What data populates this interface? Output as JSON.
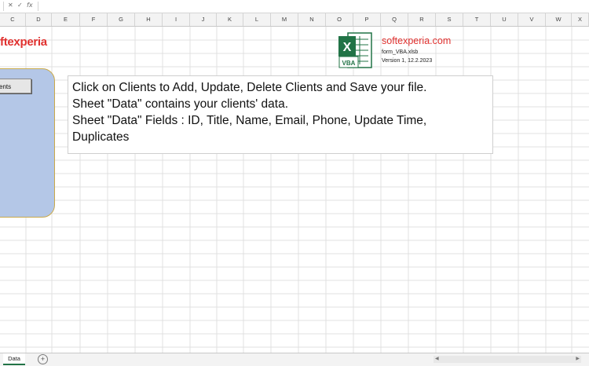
{
  "formula_bar": {
    "cancel": "✕",
    "enter": "✓",
    "fx": "fx"
  },
  "columns": [
    "C",
    "D",
    "E",
    "F",
    "G",
    "H",
    "I",
    "J",
    "K",
    "L",
    "M",
    "N",
    "O",
    "P",
    "Q",
    "R",
    "S",
    "T",
    "U",
    "V",
    "W",
    "X"
  ],
  "logo_text": "ftexperia",
  "clients_button_label": "ents",
  "info_lines": [
    "Click on Clients to Add, Update, Delete Clients and Save your file.",
    "Sheet \"Data\" contains your clients' data.",
    "Sheet \"Data\" Fields : ID, Title, Name, Email, Phone, Update Time,",
    "Duplicates"
  ],
  "brand": {
    "site": "softexperia.com",
    "file": "form_VBA.xlsb",
    "version": "Version 1, 12.2.2023",
    "icon_letter": "X",
    "icon_badge": "VBA"
  },
  "sheet_tabs": [
    {
      "label": "Data"
    }
  ],
  "add_sheet": "+",
  "colors": {
    "brand_red": "#e0312f",
    "panel_fill": "#b4c7e7",
    "panel_border": "#c9a94a",
    "excel_green": "#217346"
  }
}
